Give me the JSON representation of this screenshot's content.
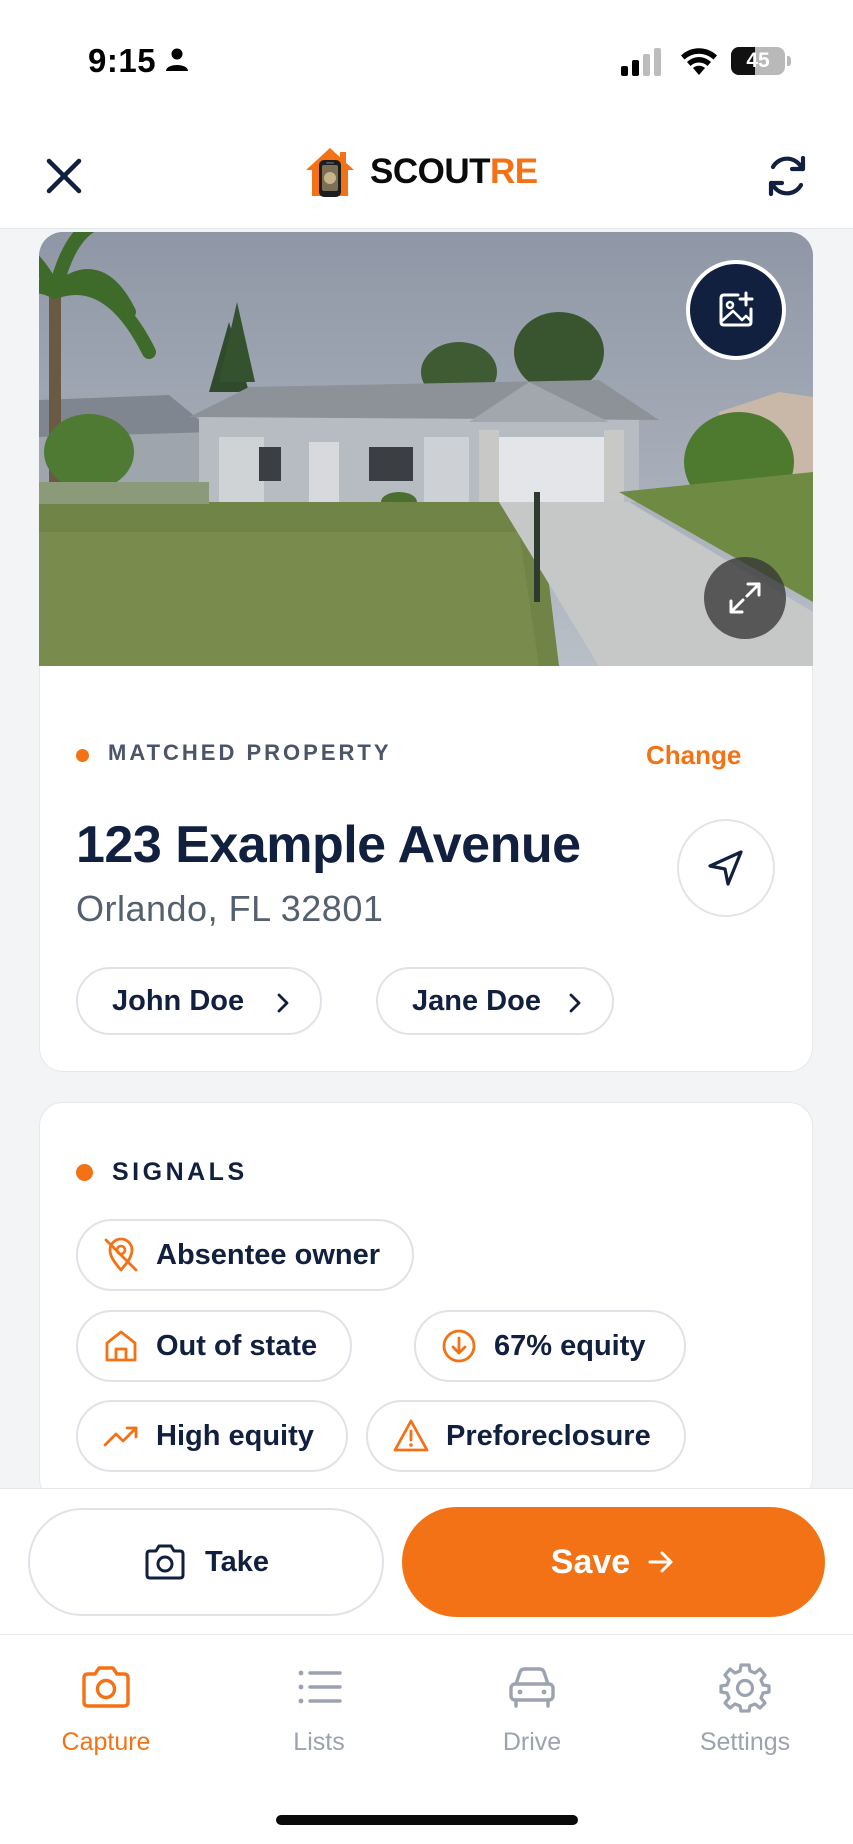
{
  "status_bar": {
    "time": "9:15",
    "battery": "45",
    "battery_level": 0.45
  },
  "header": {
    "brand_main": "SCOUT",
    "brand_accent": "RE",
    "close_icon": "close-icon",
    "refresh_icon": "refresh-icon"
  },
  "photo": {
    "add_photo_icon": "add-photo-icon",
    "expand_icon": "expand-icon"
  },
  "property": {
    "section_label": "MATCHED PROPERTY",
    "change_label": "Change",
    "street": "123 Example Avenue",
    "city": "Orlando, FL 32801",
    "owners": [
      "John Doe",
      "Jane Doe"
    ]
  },
  "signals": {
    "section_label": "SIGNALS",
    "items": [
      {
        "label": "Absentee owner",
        "icon": "location-off-icon"
      },
      {
        "label": "Out of state",
        "icon": "home-icon"
      },
      {
        "label": "67% equity",
        "icon": "arrow-down-circle-icon"
      },
      {
        "label": "High equity",
        "icon": "trending-up-icon"
      },
      {
        "label": "Preforeclosure",
        "icon": "warning-icon"
      }
    ]
  },
  "actions": {
    "take_label": "Take",
    "save_label": "Save"
  },
  "tabs": [
    {
      "label": "Capture",
      "icon": "camera-icon",
      "active": true
    },
    {
      "label": "Lists",
      "icon": "list-icon",
      "active": false
    },
    {
      "label": "Drive",
      "icon": "car-icon",
      "active": false
    },
    {
      "label": "Settings",
      "icon": "gear-icon",
      "active": false
    }
  ],
  "colors": {
    "accent": "#f47216",
    "navy": "#12203f",
    "muted": "#9aa3af"
  }
}
